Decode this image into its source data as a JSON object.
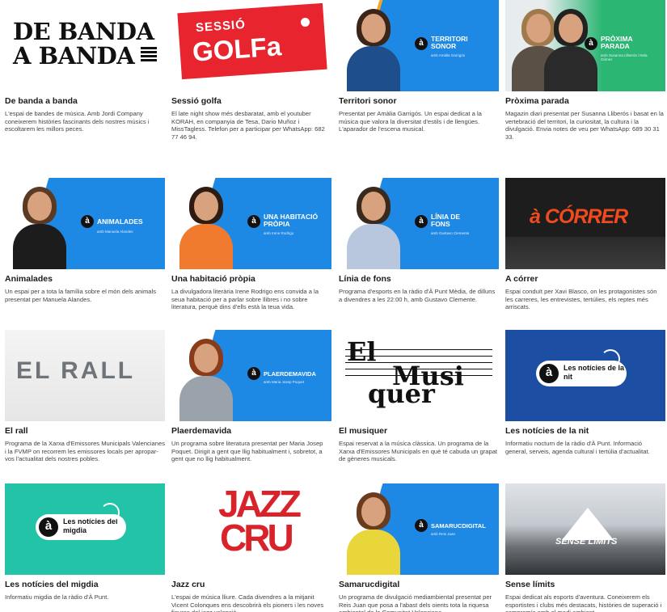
{
  "programs": [
    {
      "id": "debanda",
      "title": "De banda a banda",
      "desc": "L'espai de bandes de música. Amb Jordi Company coneixerem històries fascinants dels nostres músics i escoltarem les millors peces.",
      "thumb_text": "DE BANDA\nA BANDA"
    },
    {
      "id": "golfa",
      "title": "Sessió golfa",
      "desc": "El late night show més desbaratat, amb el youtuber KORAH, en companyia de Tesa, Dario Muñoz i MissTagless. Telefon per a participar per WhatsApp: 682 77 46 94.",
      "thumb_sessio": "SESSIÓ",
      "thumb_golfa": "GOLFa"
    },
    {
      "id": "territori",
      "title": "Territori sonor",
      "desc": "Presentat per Amàlia Garrigós. Un espai dedicat a la música que valora la diversitat d'estils i de llengües. L'aparador de l'escena musical.",
      "thumb_label": "TERRITORI SONOR",
      "thumb_sub": "amb Amàlia Garrigós"
    },
    {
      "id": "proxima",
      "title": "Pròxima parada",
      "desc": "Magazin diari presentat per Susanna Lliberós i basat en la vertebració del territori, la curiositat, la cultura i la divulgació. Envia notes de veu per WhatsApp: 689 30 31 33.",
      "thumb_label": "PRÒXIMA PARADA",
      "thumb_sub": "amb Susanna Lliberós i Nela Gómez"
    },
    {
      "id": "animalades",
      "title": "Animalades",
      "desc": "Un espai per a tota la família sobre el món dels animals presentat per Manuela Alandes.",
      "thumb_label": "ANIMALADES",
      "thumb_sub": "amb Manuela Alandes"
    },
    {
      "id": "habitacio",
      "title": "Una habitació pròpia",
      "desc": "La divulgadora literària Irene Rodrigo ens convida a la seua habitació per a parlar sobre llibres i no sobre literatura, perquè dins d'ells està la teua vida.",
      "thumb_label": "UNA HABITACIÓ PRÒPIA",
      "thumb_sub": "amb Irene Rodrigo"
    },
    {
      "id": "linia",
      "title": "Línia de fons",
      "desc": "Programa d'esports en la ràdio d'À Punt Mèdia, de dilluns a divendres a les 22:00 h, amb Gustavo Clemente.",
      "thumb_label": "LÍNIA DE FONS",
      "thumb_sub": "amb Gustavo Clemente"
    },
    {
      "id": "acorrer",
      "title": "A córrer",
      "desc": "Espai conduït per Xavi Blasco, on les protagonistes són les carreres, les entrevistes, tertúlies, els reptes més arriscats.",
      "thumb_text": "à CÓRRER"
    },
    {
      "id": "rall",
      "title": "El rall",
      "desc": "Programa de la Xarxa d'Emissores Municipals Valencianes i la FVMP on recorrem les emissores locals per apropar-vos l'actualitat dels nostres pobles.",
      "thumb_text": "EL RALL"
    },
    {
      "id": "plaer",
      "title": "Plaerdemavida",
      "desc": "Un programa sobre literatura presentat per Maria Josep Poquet. Dirigit a gent que llig habitualment i, sobretot, a gent que no llig habitualment.",
      "thumb_label": "PLAERDEMAVIDA",
      "thumb_sub": "amb Maria Josep Poquet"
    },
    {
      "id": "musiquer",
      "title": "El musiquer",
      "desc": "Espai reservat a la música clàssica. Un programa de la Xarxa d'Emissores Municipals en què té cabuda un grapat de gèneres musicals.",
      "thumb_1": "El",
      "thumb_2": "Musi",
      "thumb_3": "quer"
    },
    {
      "id": "nit",
      "title": "Les notícies de la nit",
      "desc": "Informatiu nocturn de la ràdio d'À Punt. Informació general, serveis, agenda cultural i tertúlia d'actualitat.",
      "thumb_text": "Les notícies de la nit"
    },
    {
      "id": "migdia",
      "title": "Les notícies del migdia",
      "desc": "Informatiu migdia de la ràdio d'À Punt.",
      "thumb_text": "Les notícies del migdia"
    },
    {
      "id": "jazz",
      "title": "Jazz cru",
      "desc": "L'espai de música lliure. Cada divendres a la mitjanit Vicent Colonques ens descobrirà els pioners i les noves figures del jazz valencià.",
      "thumb_1": "JAZZ",
      "thumb_2": "CRU"
    },
    {
      "id": "samaruc",
      "title": "Samarucdigital",
      "desc": "Un programa de divulgació mediambiental presentat per Reis Juan que posa a l'abast dels oients tota la riquesa ambiental de la Comunitat Valenciana.",
      "thumb_label": "SAMARUCDIGITAL",
      "thumb_sub": "amb Reis Juan"
    },
    {
      "id": "sense",
      "title": "Sense límits",
      "desc": "Espai dedicat als esports d'aventura. Coneixerem els esportistes i clubs més destacats, històries de superació i compromís amb el medi ambient.",
      "thumb_text": "SENSE LÍMITS"
    }
  ],
  "logo_glyph": "à",
  "colors": {
    "blue": "#1e88e5",
    "red": "#e8242f",
    "teal": "#22c3a7",
    "navy": "#1c4fa3",
    "orange": "#f5a623"
  }
}
